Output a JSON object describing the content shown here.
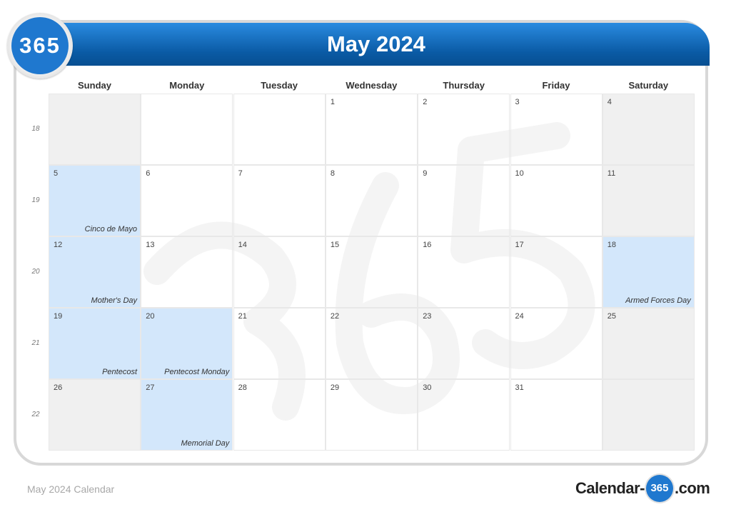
{
  "logo": {
    "text": "365"
  },
  "header": {
    "title": "May 2024"
  },
  "weekdays": [
    "Sunday",
    "Monday",
    "Tuesday",
    "Wednesday",
    "Thursday",
    "Friday",
    "Saturday"
  ],
  "week_numbers": [
    "18",
    "19",
    "20",
    "21",
    "22"
  ],
  "weeks": [
    [
      {
        "day": "",
        "type": "empty"
      },
      {
        "day": "",
        "type": "blank"
      },
      {
        "day": "",
        "type": "blank"
      },
      {
        "day": "1",
        "type": "normal"
      },
      {
        "day": "2",
        "type": "normal"
      },
      {
        "day": "3",
        "type": "normal"
      },
      {
        "day": "4",
        "type": "weekend"
      }
    ],
    [
      {
        "day": "5",
        "type": "holiday",
        "holiday": "Cinco de Mayo"
      },
      {
        "day": "6",
        "type": "normal"
      },
      {
        "day": "7",
        "type": "normal"
      },
      {
        "day": "8",
        "type": "normal"
      },
      {
        "day": "9",
        "type": "normal"
      },
      {
        "day": "10",
        "type": "normal"
      },
      {
        "day": "11",
        "type": "weekend"
      }
    ],
    [
      {
        "day": "12",
        "type": "holiday",
        "holiday": "Mother's Day"
      },
      {
        "day": "13",
        "type": "normal"
      },
      {
        "day": "14",
        "type": "normal"
      },
      {
        "day": "15",
        "type": "normal"
      },
      {
        "day": "16",
        "type": "normal"
      },
      {
        "day": "17",
        "type": "normal"
      },
      {
        "day": "18",
        "type": "holiday",
        "holiday": "Armed Forces Day"
      }
    ],
    [
      {
        "day": "19",
        "type": "holiday",
        "holiday": "Pentecost"
      },
      {
        "day": "20",
        "type": "holiday",
        "holiday": "Pentecost Monday"
      },
      {
        "day": "21",
        "type": "normal"
      },
      {
        "day": "22",
        "type": "normal"
      },
      {
        "day": "23",
        "type": "normal"
      },
      {
        "day": "24",
        "type": "normal"
      },
      {
        "day": "25",
        "type": "weekend"
      }
    ],
    [
      {
        "day": "26",
        "type": "weekend"
      },
      {
        "day": "27",
        "type": "holiday",
        "holiday": "Memorial Day"
      },
      {
        "day": "28",
        "type": "normal"
      },
      {
        "day": "29",
        "type": "normal"
      },
      {
        "day": "30",
        "type": "normal"
      },
      {
        "day": "31",
        "type": "normal"
      },
      {
        "day": "",
        "type": "empty"
      }
    ]
  ],
  "footer": {
    "title": "May 2024 Calendar",
    "brand_prefix": "Calendar-",
    "brand_number": "365",
    "brand_suffix": ".com"
  },
  "colors": {
    "banner": "#1f78cf",
    "holiday": "#d3e7fb",
    "weekend": "#f0f0f0"
  }
}
